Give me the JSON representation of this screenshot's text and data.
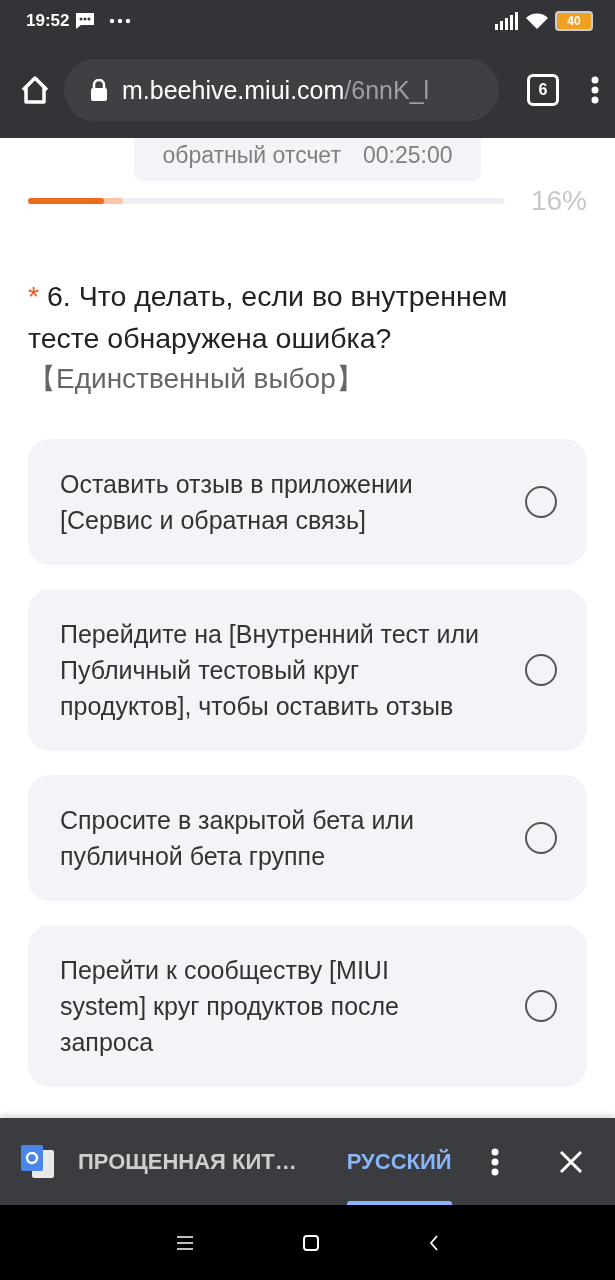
{
  "status_bar": {
    "time": "19:52",
    "battery": "40"
  },
  "browser": {
    "url_host": "m.beehive.miui.com",
    "url_path": "/6nnK_l",
    "tab_count": "6"
  },
  "countdown": {
    "label": "обратный отсчет",
    "time": "00:25:00"
  },
  "progress": {
    "level": 0.16,
    "reading": "16%"
  },
  "question": {
    "required_mark": "*",
    "text": "6. Что делать, если во внутреннем тесте обнаружена ошибка?",
    "type_label": "【Единственный выбор】"
  },
  "options": [
    {
      "text": "Оставить отзыв в приложении [Сервис и обратная связь]",
      "selected": false
    },
    {
      "text": "Перейдите на [Внутренний тест или Публичный тестовый круг продуктов], чтобы оставить отзыв",
      "selected": false
    },
    {
      "text": "Спросите в закрытой бета или публичной бета группе",
      "selected": false
    },
    {
      "text": "Перейти к сообществу [MIUI system] круг продуктов после запроса",
      "selected": false
    }
  ],
  "translate_bar": {
    "tabs": [
      {
        "label": "ПРОЩЕННАЯ КИТ…",
        "selected": false
      },
      {
        "label": "РУССКИЙ",
        "selected": true
      }
    ]
  }
}
